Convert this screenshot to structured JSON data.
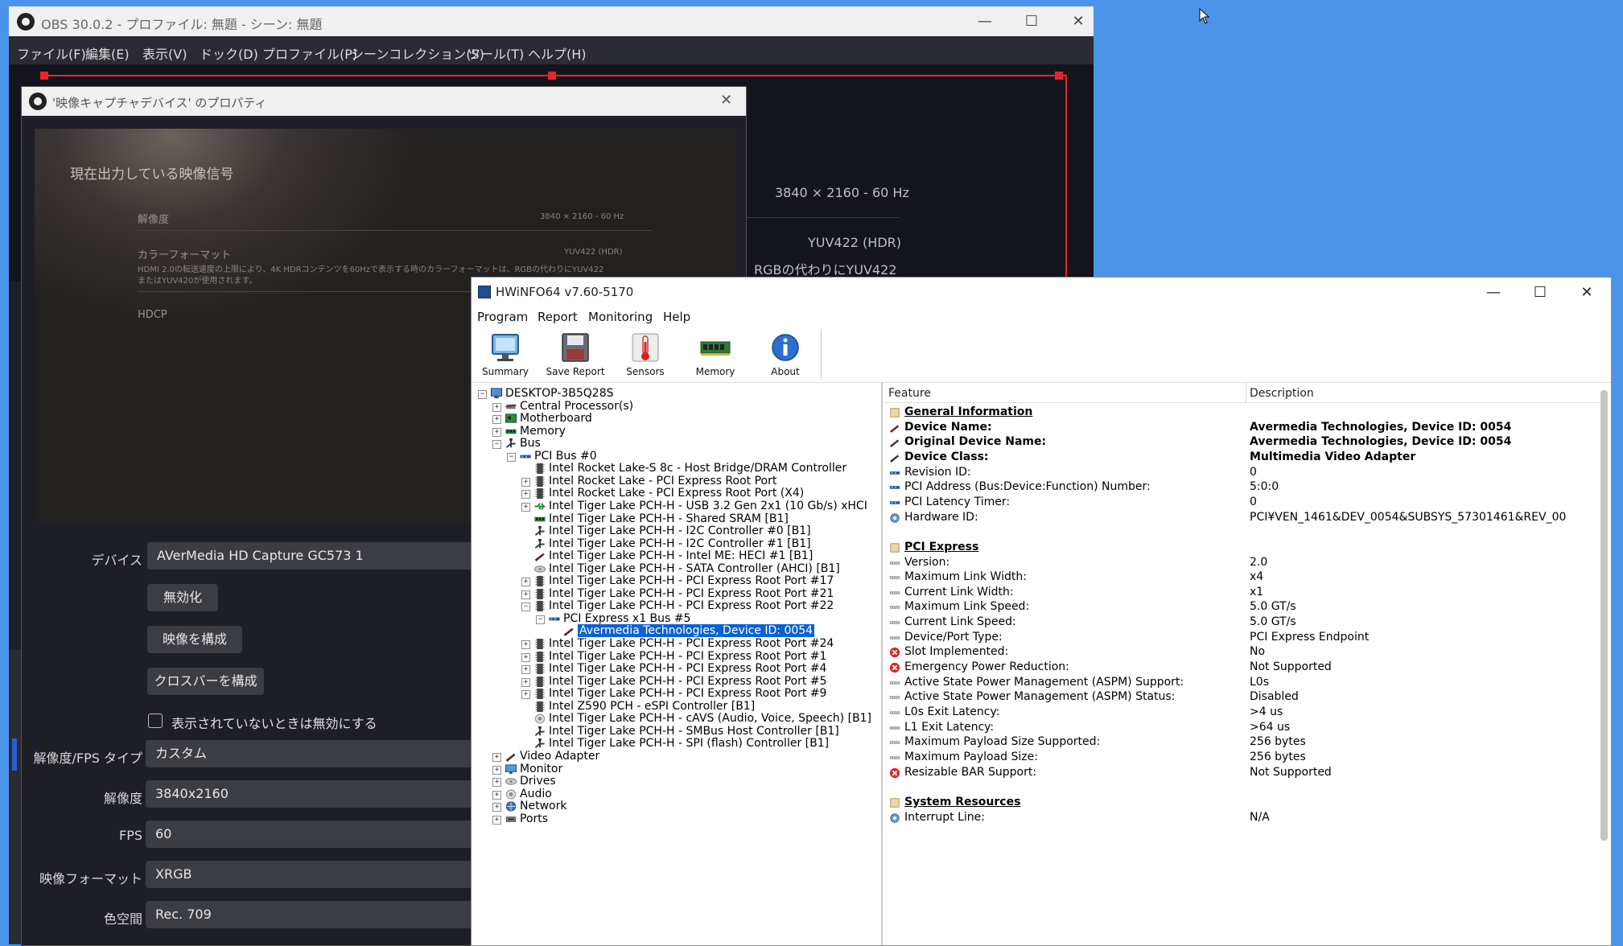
{
  "obs": {
    "window_title": "OBS 30.0.2 - プロファイル: 無題 - シーン: 無題",
    "menu": [
      "ファイル(F)",
      "編集(E)",
      "表示(V)",
      "ドック(D)",
      "プロファイル(P)",
      "シーンコレクション(S)",
      "ツール(T)",
      "ヘルプ(H)"
    ],
    "preview": {
      "resolution": "3840 × 2160 - 60 Hz",
      "format": "YUV422 (HDR)",
      "note": "RGBの代わりにYUV422"
    }
  },
  "props": {
    "title": "'映像キャプチャデバイス' のプロパティ",
    "preview": {
      "heading": "現在出力している映像信号",
      "resolution_label": "解像度",
      "resolution_value": "3840 × 2160 - 60 Hz",
      "format_label": "カラーフォーマット",
      "format_value": "YUV422 (HDR)",
      "format_note_1": "HDMI 2.0の転送速度の上限により、4K HDRコンテンツを60Hzで表示する時のカラーフォーマットは、RGBの代わりにYUV422",
      "format_note_2": "またはYUV420が使用されます。",
      "hdcp_label": "HDCP"
    },
    "device_label": "デバイス",
    "device_value": "AVerMedia HD Capture GC573 1",
    "btn_disable": "無効化",
    "btn_configure_video": "映像を構成",
    "btn_configure_crossbar": "クロスバーを構成",
    "checkbox_label": "表示されていないときは無効にする",
    "fields": [
      {
        "label": "解像度/FPS タイプ",
        "value": "カスタム"
      },
      {
        "label": "解像度",
        "value": "3840x2160"
      },
      {
        "label": "FPS",
        "value": "60"
      },
      {
        "label": "映像フォーマット",
        "value": "XRGB"
      },
      {
        "label": "色空間",
        "value": "Rec. 709"
      }
    ]
  },
  "hwinfo": {
    "title": "HWiNFO64 v7.60-5170",
    "menu": [
      "Program",
      "Report",
      "Monitoring",
      "Help"
    ],
    "toolbar": [
      {
        "label": "Summary",
        "icon": "monitor-icon"
      },
      {
        "label": "Save Report",
        "icon": "floppy-disk-icon"
      },
      {
        "label": "Sensors",
        "icon": "thermometer-icon"
      },
      {
        "label": "Memory",
        "icon": "ram-module-icon"
      },
      {
        "label": "About",
        "icon": "info-icon"
      }
    ],
    "tree": [
      {
        "label": "DESKTOP-3B5Q28S",
        "depth": 0,
        "exp": "-",
        "icon": "computer-icon"
      },
      {
        "label": "Central Processor(s)",
        "depth": 1,
        "exp": "+",
        "icon": "cpu-icon"
      },
      {
        "label": "Motherboard",
        "depth": 1,
        "exp": "+",
        "icon": "motherboard-icon"
      },
      {
        "label": "Memory",
        "depth": 1,
        "exp": "+",
        "icon": "ram-icon"
      },
      {
        "label": "Bus",
        "depth": 1,
        "exp": "-",
        "icon": "bus-icon"
      },
      {
        "label": "PCI Bus #0",
        "depth": 2,
        "exp": "-",
        "icon": "pci-icon"
      },
      {
        "label": "Intel Rocket Lake-S 8c - Host Bridge/DRAM Controller",
        "depth": 3,
        "exp": "",
        "icon": "chip-icon"
      },
      {
        "label": "Intel Rocket Lake - PCI Express Root Port",
        "depth": 3,
        "exp": "+",
        "icon": "chip-icon"
      },
      {
        "label": "Intel Rocket Lake - PCI Express Root Port (X4)",
        "depth": 3,
        "exp": "+",
        "icon": "chip-icon"
      },
      {
        "label": "Intel Tiger Lake PCH-H - USB 3.2 Gen 2x1 (10 Gb/s) xHCI",
        "depth": 3,
        "exp": "+",
        "icon": "usb-icon"
      },
      {
        "label": "Intel Tiger Lake PCH-H - Shared SRAM [B1]",
        "depth": 3,
        "exp": "",
        "icon": "ram-icon"
      },
      {
        "label": "Intel Tiger Lake PCH-H - I2C Controller #0 [B1]",
        "depth": 3,
        "exp": "",
        "icon": "bus-icon"
      },
      {
        "label": "Intel Tiger Lake PCH-H - I2C Controller #1 [B1]",
        "depth": 3,
        "exp": "",
        "icon": "bus-icon"
      },
      {
        "label": "Intel Tiger Lake PCH-H - Intel ME: HECI #1 [B1]",
        "depth": 3,
        "exp": "",
        "icon": "pen-icon"
      },
      {
        "label": "Intel Tiger Lake PCH-H - SATA Controller (AHCI) [B1]",
        "depth": 3,
        "exp": "",
        "icon": "drive-icon"
      },
      {
        "label": "Intel Tiger Lake PCH-H - PCI Express Root Port #17",
        "depth": 3,
        "exp": "+",
        "icon": "chip-icon"
      },
      {
        "label": "Intel Tiger Lake PCH-H - PCI Express Root Port #21",
        "depth": 3,
        "exp": "+",
        "icon": "chip-icon"
      },
      {
        "label": "Intel Tiger Lake PCH-H - PCI Express Root Port #22",
        "depth": 3,
        "exp": "-",
        "icon": "chip-icon"
      },
      {
        "label": "PCI Express x1 Bus #5",
        "depth": 4,
        "exp": "-",
        "icon": "pci-icon"
      },
      {
        "label": "Avermedia Technologies, Device ID: 0054",
        "depth": 5,
        "exp": "",
        "icon": "pen-icon",
        "selected": true
      },
      {
        "label": "Intel Tiger Lake PCH-H - PCI Express Root Port #24",
        "depth": 3,
        "exp": "+",
        "icon": "chip-icon"
      },
      {
        "label": "Intel Tiger Lake PCH-H - PCI Express Root Port #1",
        "depth": 3,
        "exp": "+",
        "icon": "chip-icon"
      },
      {
        "label": "Intel Tiger Lake PCH-H - PCI Express Root Port #4",
        "depth": 3,
        "exp": "+",
        "icon": "chip-icon"
      },
      {
        "label": "Intel Tiger Lake PCH-H - PCI Express Root Port #5",
        "depth": 3,
        "exp": "+",
        "icon": "chip-icon"
      },
      {
        "label": "Intel Tiger Lake PCH-H - PCI Express Root Port #9",
        "depth": 3,
        "exp": "+",
        "icon": "chip-icon"
      },
      {
        "label": "Intel Z590 PCH - eSPI Controller [B1]",
        "depth": 3,
        "exp": "",
        "icon": "chip-icon"
      },
      {
        "label": "Intel Tiger Lake PCH-H - cAVS (Audio, Voice, Speech) [B1]",
        "depth": 3,
        "exp": "",
        "icon": "speaker-icon"
      },
      {
        "label": "Intel Tiger Lake PCH-H - SMBus Host Controller [B1]",
        "depth": 3,
        "exp": "",
        "icon": "bus-icon"
      },
      {
        "label": "Intel Tiger Lake PCH-H - SPI (flash) Controller [B1]",
        "depth": 3,
        "exp": "",
        "icon": "bus-icon"
      },
      {
        "label": "Video Adapter",
        "depth": 1,
        "exp": "+",
        "icon": "pen-icon"
      },
      {
        "label": "Monitor",
        "depth": 1,
        "exp": "+",
        "icon": "monitor-icon"
      },
      {
        "label": "Drives",
        "depth": 1,
        "exp": "+",
        "icon": "drive-icon"
      },
      {
        "label": "Audio",
        "depth": 1,
        "exp": "+",
        "icon": "speaker-icon"
      },
      {
        "label": "Network",
        "depth": 1,
        "exp": "+",
        "icon": "network-icon"
      },
      {
        "label": "Ports",
        "depth": 1,
        "exp": "+",
        "icon": "port-icon"
      }
    ],
    "detail_headers": {
      "feature": "Feature",
      "description": "Description"
    },
    "detail": [
      {
        "type": "section",
        "feature": "General Information",
        "value": "",
        "icon": "section-icon"
      },
      {
        "type": "bold",
        "feature": "Device Name:",
        "value": "Avermedia Technologies, Device ID: 0054",
        "icon": "pen-icon"
      },
      {
        "type": "bold",
        "feature": "Original Device Name:",
        "value": "Avermedia Technologies, Device ID: 0054",
        "icon": "pen-icon"
      },
      {
        "type": "bold",
        "feature": "Device Class:",
        "value": "Multimedia Video Adapter",
        "icon": "pen-icon"
      },
      {
        "type": "normal",
        "feature": "Revision ID:",
        "value": "0",
        "icon": "pci-icon"
      },
      {
        "type": "normal",
        "feature": "PCI Address (Bus:Device:Function) Number:",
        "value": "5:0:0",
        "icon": "pci-icon"
      },
      {
        "type": "normal",
        "feature": "PCI Latency Timer:",
        "value": "0",
        "icon": "pci-icon"
      },
      {
        "type": "normal",
        "feature": "Hardware ID:",
        "value": "PCI¥VEN_1461&DEV_0054&SUBSYS_57301461&REV_00",
        "icon": "gear-icon"
      },
      {
        "type": "blank",
        "feature": "",
        "value": "",
        "icon": ""
      },
      {
        "type": "section",
        "feature": "PCI Express",
        "value": "",
        "icon": "section-icon"
      },
      {
        "type": "normal",
        "feature": "Version:",
        "value": "2.0",
        "icon": "pcie-icon"
      },
      {
        "type": "normal",
        "feature": "Maximum Link Width:",
        "value": "x4",
        "icon": "pcie-icon"
      },
      {
        "type": "normal",
        "feature": "Current Link Width:",
        "value": "x1",
        "icon": "pcie-icon"
      },
      {
        "type": "normal",
        "feature": "Maximum Link Speed:",
        "value": "5.0 GT/s",
        "icon": "pcie-icon"
      },
      {
        "type": "normal",
        "feature": "Current Link Speed:",
        "value": "5.0 GT/s",
        "icon": "pcie-icon"
      },
      {
        "type": "normal",
        "feature": "Device/Port Type:",
        "value": "PCI Express Endpoint",
        "icon": "pcie-icon"
      },
      {
        "type": "normal",
        "feature": "Slot Implemented:",
        "value": "No",
        "icon": "error-icon"
      },
      {
        "type": "normal",
        "feature": "Emergency Power Reduction:",
        "value": "Not Supported",
        "icon": "error-icon"
      },
      {
        "type": "normal",
        "feature": "Active State Power Management (ASPM) Support:",
        "value": "L0s",
        "icon": "pcie-icon"
      },
      {
        "type": "normal",
        "feature": "Active State Power Management (ASPM) Status:",
        "value": "Disabled",
        "icon": "pcie-icon"
      },
      {
        "type": "normal",
        "feature": "L0s Exit Latency:",
        "value": ">4 us",
        "icon": "pcie-icon"
      },
      {
        "type": "normal",
        "feature": "L1 Exit Latency:",
        "value": ">64 us",
        "icon": "pcie-icon"
      },
      {
        "type": "normal",
        "feature": "Maximum Payload Size Supported:",
        "value": "256 bytes",
        "icon": "pcie-icon"
      },
      {
        "type": "normal",
        "feature": "Maximum Payload Size:",
        "value": "256 bytes",
        "icon": "pcie-icon"
      },
      {
        "type": "normal",
        "feature": "Resizable BAR Support:",
        "value": "Not Supported",
        "icon": "error-icon"
      },
      {
        "type": "blank",
        "feature": "",
        "value": "",
        "icon": ""
      },
      {
        "type": "section",
        "feature": "System Resources",
        "value": "",
        "icon": "section-icon"
      },
      {
        "type": "normal",
        "feature": "Interrupt Line:",
        "value": "N/A",
        "icon": "gear-icon"
      }
    ]
  }
}
